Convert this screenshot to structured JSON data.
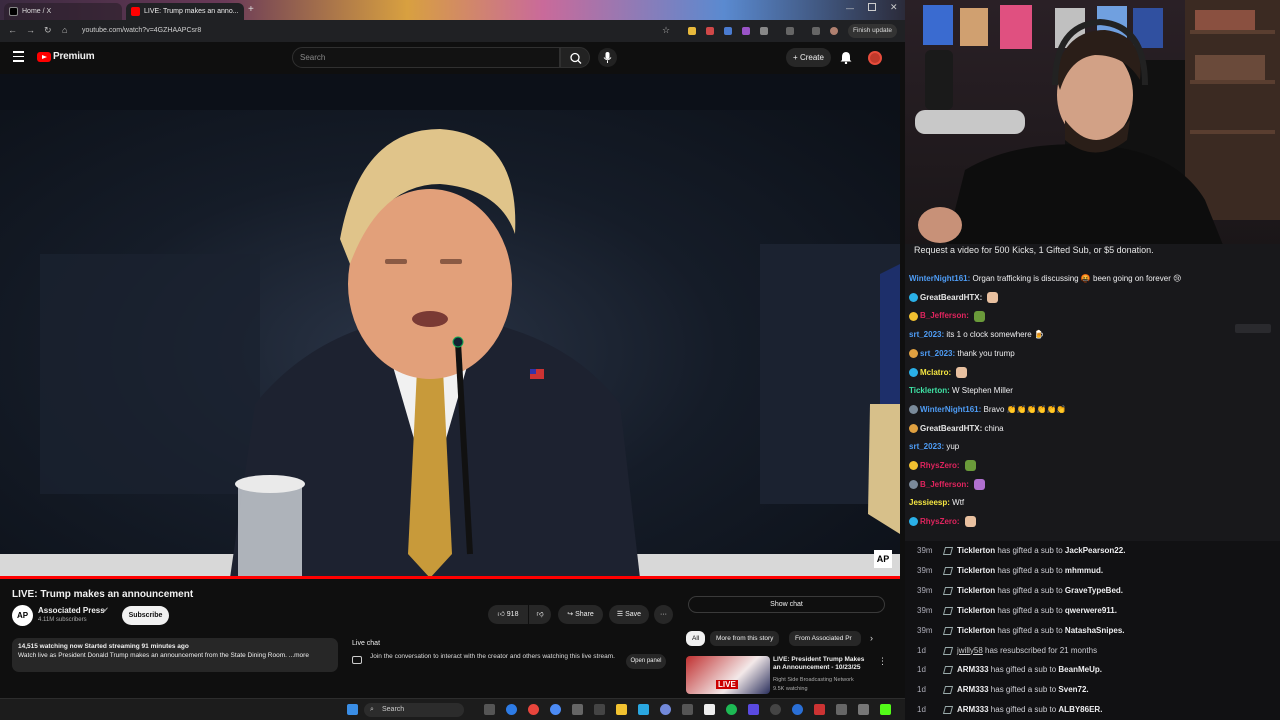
{
  "browser": {
    "tabs": [
      {
        "label": "Home / X"
      },
      {
        "label": "LIVE: Trump makes an anno..."
      }
    ],
    "url": "youtube.com/watch?v=4GZHAAPCsr8",
    "finish_update": "Finish update"
  },
  "youtube": {
    "logo_text": "Premium",
    "search_placeholder": "Search",
    "create_label": "Create",
    "video_corner_logo": "AP",
    "progress": 1.0,
    "title": "LIVE: Trump makes an announcement",
    "channel": {
      "name": "Associated Press",
      "subscribers": "4.11M subscribers",
      "avatar_text": "AP"
    },
    "subscribe_label": "Subscribe",
    "like_count": "918",
    "share_label": "Share",
    "save_label": "Save",
    "more_label": "···",
    "description": {
      "stats": "14,515 watching now  Started streaming 91 minutes ago",
      "text": "Watch live as President Donald Trump makes an announcement from the State Dining Room. ...more"
    },
    "live_chat": {
      "heading": "Live chat",
      "text": "Join the conversation to interact with the creator and others watching this live stream.",
      "open_panel": "Open panel"
    },
    "show_chat_label": "Show chat",
    "chips": [
      "All",
      "More from this story",
      "From Associated Pr"
    ],
    "recommended": {
      "title": "LIVE: President Trump Makes an Announcement - 10/23/25",
      "channel": "Right Side Broadcasting Network",
      "stats": "9.5K watching",
      "thumb_badge": "LIVE"
    }
  },
  "taskbar": {
    "search_label": "Search"
  },
  "stream_chat": {
    "banner": "Request a video for 500 Kicks, 1 Gifted Sub, or $5 donation.",
    "messages": [
      {
        "user": "WinterNight161:",
        "text": "Organ trafficking is discussing 🤬 been going on forever 😢",
        "color": "#4e9cf5"
      },
      {
        "user": "GreatBeardHTX:",
        "text": "",
        "color": "#e6e6e6"
      },
      {
        "user": "B_Jefferson:",
        "text": "",
        "color": "#e0245e"
      },
      {
        "user": "srt_2023:",
        "text": "its 1 o clock somewhere 🍺",
        "color": "#4e9cf5"
      },
      {
        "user": "srt_2023:",
        "text": "thank you trump",
        "color": "#4e9cf5"
      },
      {
        "user": "Mclatro:",
        "text": "",
        "color": "#f5e642"
      },
      {
        "user": "Ticklerton:",
        "text": "W Stephen Miller",
        "color": "#3fe2a5"
      },
      {
        "user": "WinterNight161:",
        "text": "Bravo 👏👏👏👏👏👏",
        "color": "#4e9cf5"
      },
      {
        "user": "GreatBeardHTX:",
        "text": "china",
        "color": "#e6e6e6"
      },
      {
        "user": "srt_2023:",
        "text": "yup",
        "color": "#4e9cf5"
      },
      {
        "user": "RhysZero:",
        "text": "",
        "color": "#e0245e"
      },
      {
        "user": "B_Jefferson:",
        "text": "",
        "color": "#e0245e"
      },
      {
        "user": "Jessieesp:",
        "text": "Wtf",
        "color": "#f5e642"
      },
      {
        "user": "RhysZero:",
        "text": "",
        "color": "#e0245e"
      }
    ]
  },
  "events": [
    {
      "time": "39m",
      "user": "Ticklerton",
      "action": "has gifted a sub to",
      "target": "JackPearson22."
    },
    {
      "time": "39m",
      "user": "Ticklerton",
      "action": "has gifted a sub to",
      "target": "mhmmud."
    },
    {
      "time": "39m",
      "user": "Ticklerton",
      "action": "has gifted a sub to",
      "target": "GraveTypeBed."
    },
    {
      "time": "39m",
      "user": "Ticklerton",
      "action": "has gifted a sub to",
      "target": "qwerwere911."
    },
    {
      "time": "39m",
      "user": "Ticklerton",
      "action": "has gifted a sub to",
      "target": "NatashaSnipes."
    },
    {
      "time": "1d",
      "user": "jwilly58",
      "action": "has resubscribed for 21 months",
      "target": ""
    },
    {
      "time": "1d",
      "user": "ARM333",
      "action": "has gifted a sub to",
      "target": "BeanMeUp."
    },
    {
      "time": "1d",
      "user": "ARM333",
      "action": "has gifted a sub to",
      "target": "Sven72."
    },
    {
      "time": "1d",
      "user": "ARM333",
      "action": "has gifted a sub to",
      "target": "ALBY86ER."
    }
  ]
}
